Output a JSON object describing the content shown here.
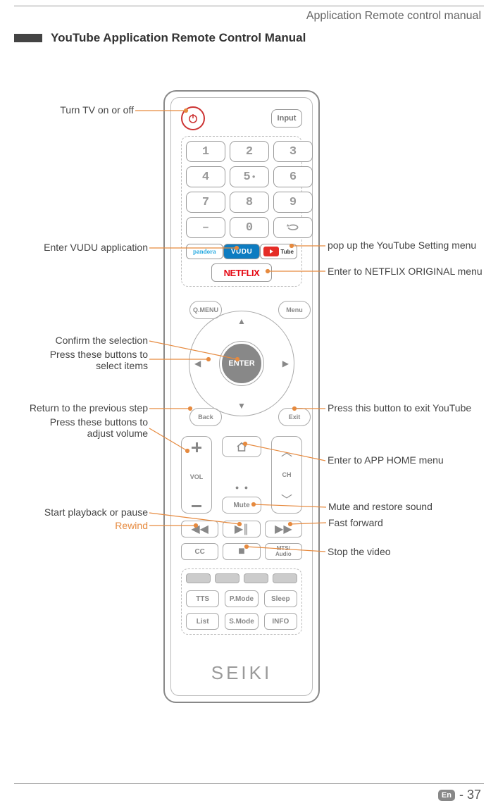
{
  "page": {
    "header": "Application Remote control manual",
    "title": "YouTube Application Remote Control Manual",
    "footer_lang": "En",
    "footer_page": "- 37"
  },
  "remote": {
    "input": "Input",
    "numbers": [
      "1",
      "2",
      "3",
      "4",
      "5",
      "6",
      "7",
      "8",
      "9",
      "–",
      "0",
      "↻"
    ],
    "pandora": "pandora",
    "vudu": "VUDU",
    "youtube": "Tube",
    "netflix": "NETFLIX",
    "qmenu": "Q.MENU",
    "menu": "Menu",
    "enter": "ENTER",
    "back": "Back",
    "exit": "Exit",
    "vol": "VOL",
    "ch": "CH",
    "mute": "Mute",
    "cc": "CC",
    "mts": "MTS/\nAudio",
    "row1": [
      "TTS",
      "P.Mode",
      "Sleep"
    ],
    "row2": [
      "List",
      "S.Mode",
      "INFO"
    ],
    "brand": "SEIKI"
  },
  "callouts": {
    "power": "Turn TV on or off",
    "vudu": "Enter VUDU application",
    "youtube": "pop up the YouTube Setting menu",
    "netflix": "Enter to NETFLIX ORIGINAL menu",
    "enter": "Confirm the selection",
    "arrows": "Press these buttons to\nselect items",
    "back": "Return to the previous step",
    "vol": "Press these buttons to\nadjust volume",
    "exit": "Press this button to exit YouTube",
    "home": "Enter to APP HOME menu",
    "mute": "Mute and restore sound",
    "play": "Start playback or pause",
    "rew": "Rewind",
    "ff": "Fast forward",
    "stop": "Stop the video"
  }
}
